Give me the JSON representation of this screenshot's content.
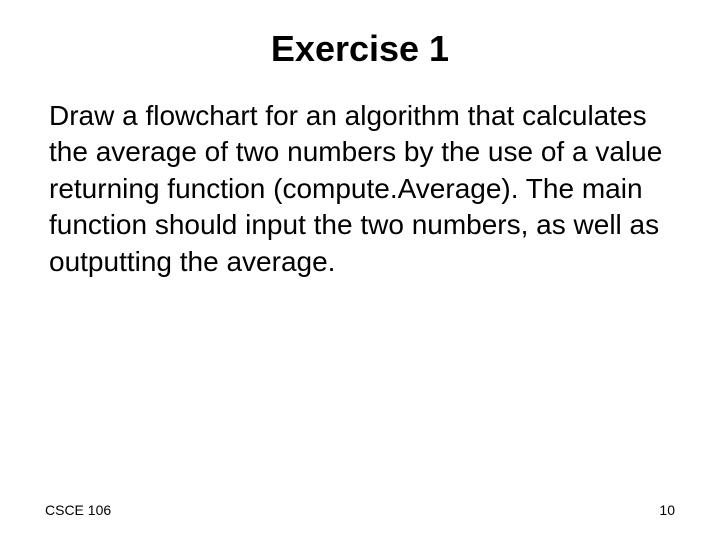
{
  "slide": {
    "title": "Exercise 1",
    "body": "Draw a flowchart for an algorithm that calculates the average of two numbers by the use of a value returning function (compute.Average). The main function should input the two numbers, as well as outputting the average."
  },
  "footer": {
    "course": "CSCE 106",
    "page": "10"
  }
}
